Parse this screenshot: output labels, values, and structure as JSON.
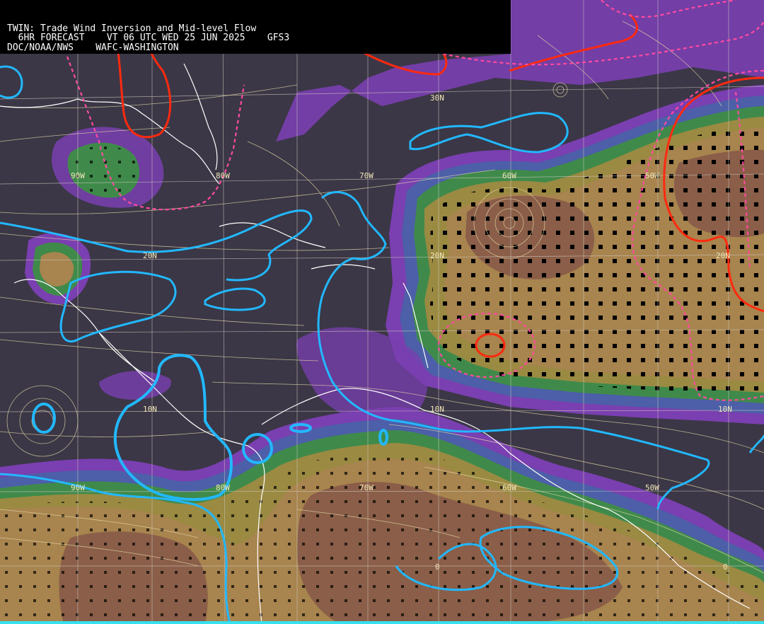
{
  "header": {
    "line1": "TWIN: Trade Wind Inversion and Mid-level Flow",
    "line2": "  6HR FORECAST    VT 06 UTC WED 25 JUN 2025    GFS3",
    "line3": "DOC/NOAA/NWS    WAFC-WASHINGTON"
  },
  "grid_labels": {
    "lon_top": [
      "90W",
      "80W",
      "70W",
      "60W",
      "50W"
    ],
    "lat_top": [
      "30N",
      "20N",
      "20N",
      "20N"
    ],
    "lon_bottom": [
      "90W",
      "80W",
      "70W",
      "60W",
      "50W"
    ],
    "lat_mid": [
      "10N",
      "10N",
      "10N"
    ],
    "equator": [
      "0",
      "0"
    ]
  },
  "colors": {
    "background": "#3b3746",
    "purple_band": "#7a3fb0",
    "blue_band": "#4c5fa8",
    "green_band": "#3f8a4a",
    "olive_band": "#9a8a42",
    "tan_band": "#a8844e",
    "brown_band": "#8a5e48",
    "streamline": "#e8dcaa",
    "grid": "#cfc7c0",
    "coast": "#ffffff",
    "contour_cyan": "#22b8ff",
    "contour_red": "#ff2a10",
    "contour_pink_dashed": "#ff4aa0",
    "bottom_bar": "#37e0ee"
  }
}
